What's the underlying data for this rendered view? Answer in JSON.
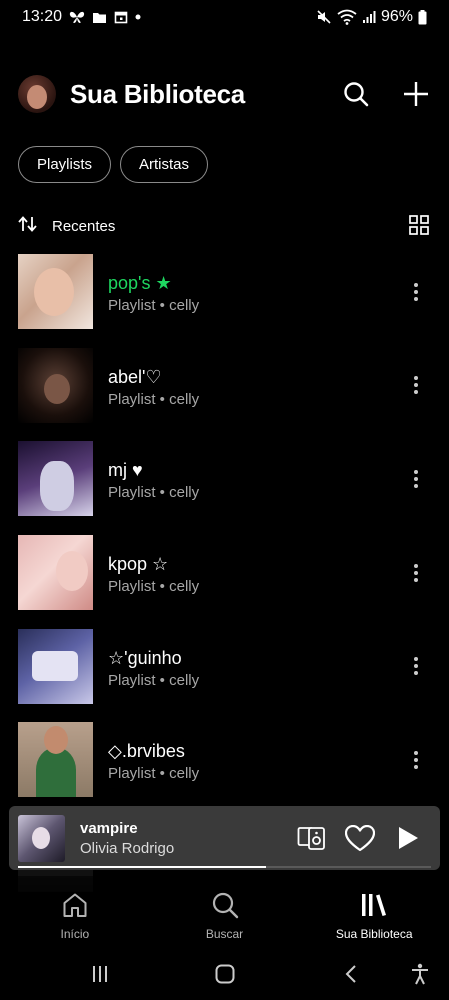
{
  "status_bar": {
    "time": "13:20",
    "battery": "96%"
  },
  "header": {
    "title": "Sua Biblioteca"
  },
  "filters": [
    {
      "label": "Playlists"
    },
    {
      "label": "Artistas"
    }
  ],
  "sort": {
    "label": "Recentes"
  },
  "playlists": [
    {
      "title": "pop's ★",
      "subtitle": "Playlist • celly",
      "active": true
    },
    {
      "title": "abel'♡",
      "subtitle": "Playlist • celly"
    },
    {
      "title": "mj ♥",
      "subtitle": "Playlist • celly"
    },
    {
      "title": "kpop ☆",
      "subtitle": "Playlist • celly"
    },
    {
      "title": "☆'guinho",
      "subtitle": "Playlist • celly"
    },
    {
      "title": "◇.brvibes",
      "subtitle": "Playlist • celly"
    }
  ],
  "now_playing": {
    "title": "vampire",
    "artist": "Olivia Rodrigo",
    "progress": 0.6
  },
  "bottom_nav": [
    {
      "label": "Início",
      "icon": "home-icon"
    },
    {
      "label": "Buscar",
      "icon": "search-icon"
    },
    {
      "label": "Sua Biblioteca",
      "icon": "library-icon",
      "active": true
    }
  ],
  "colors": {
    "accent": "#1ed760",
    "background": "#000000",
    "mini_player": "#3a3a3a"
  }
}
